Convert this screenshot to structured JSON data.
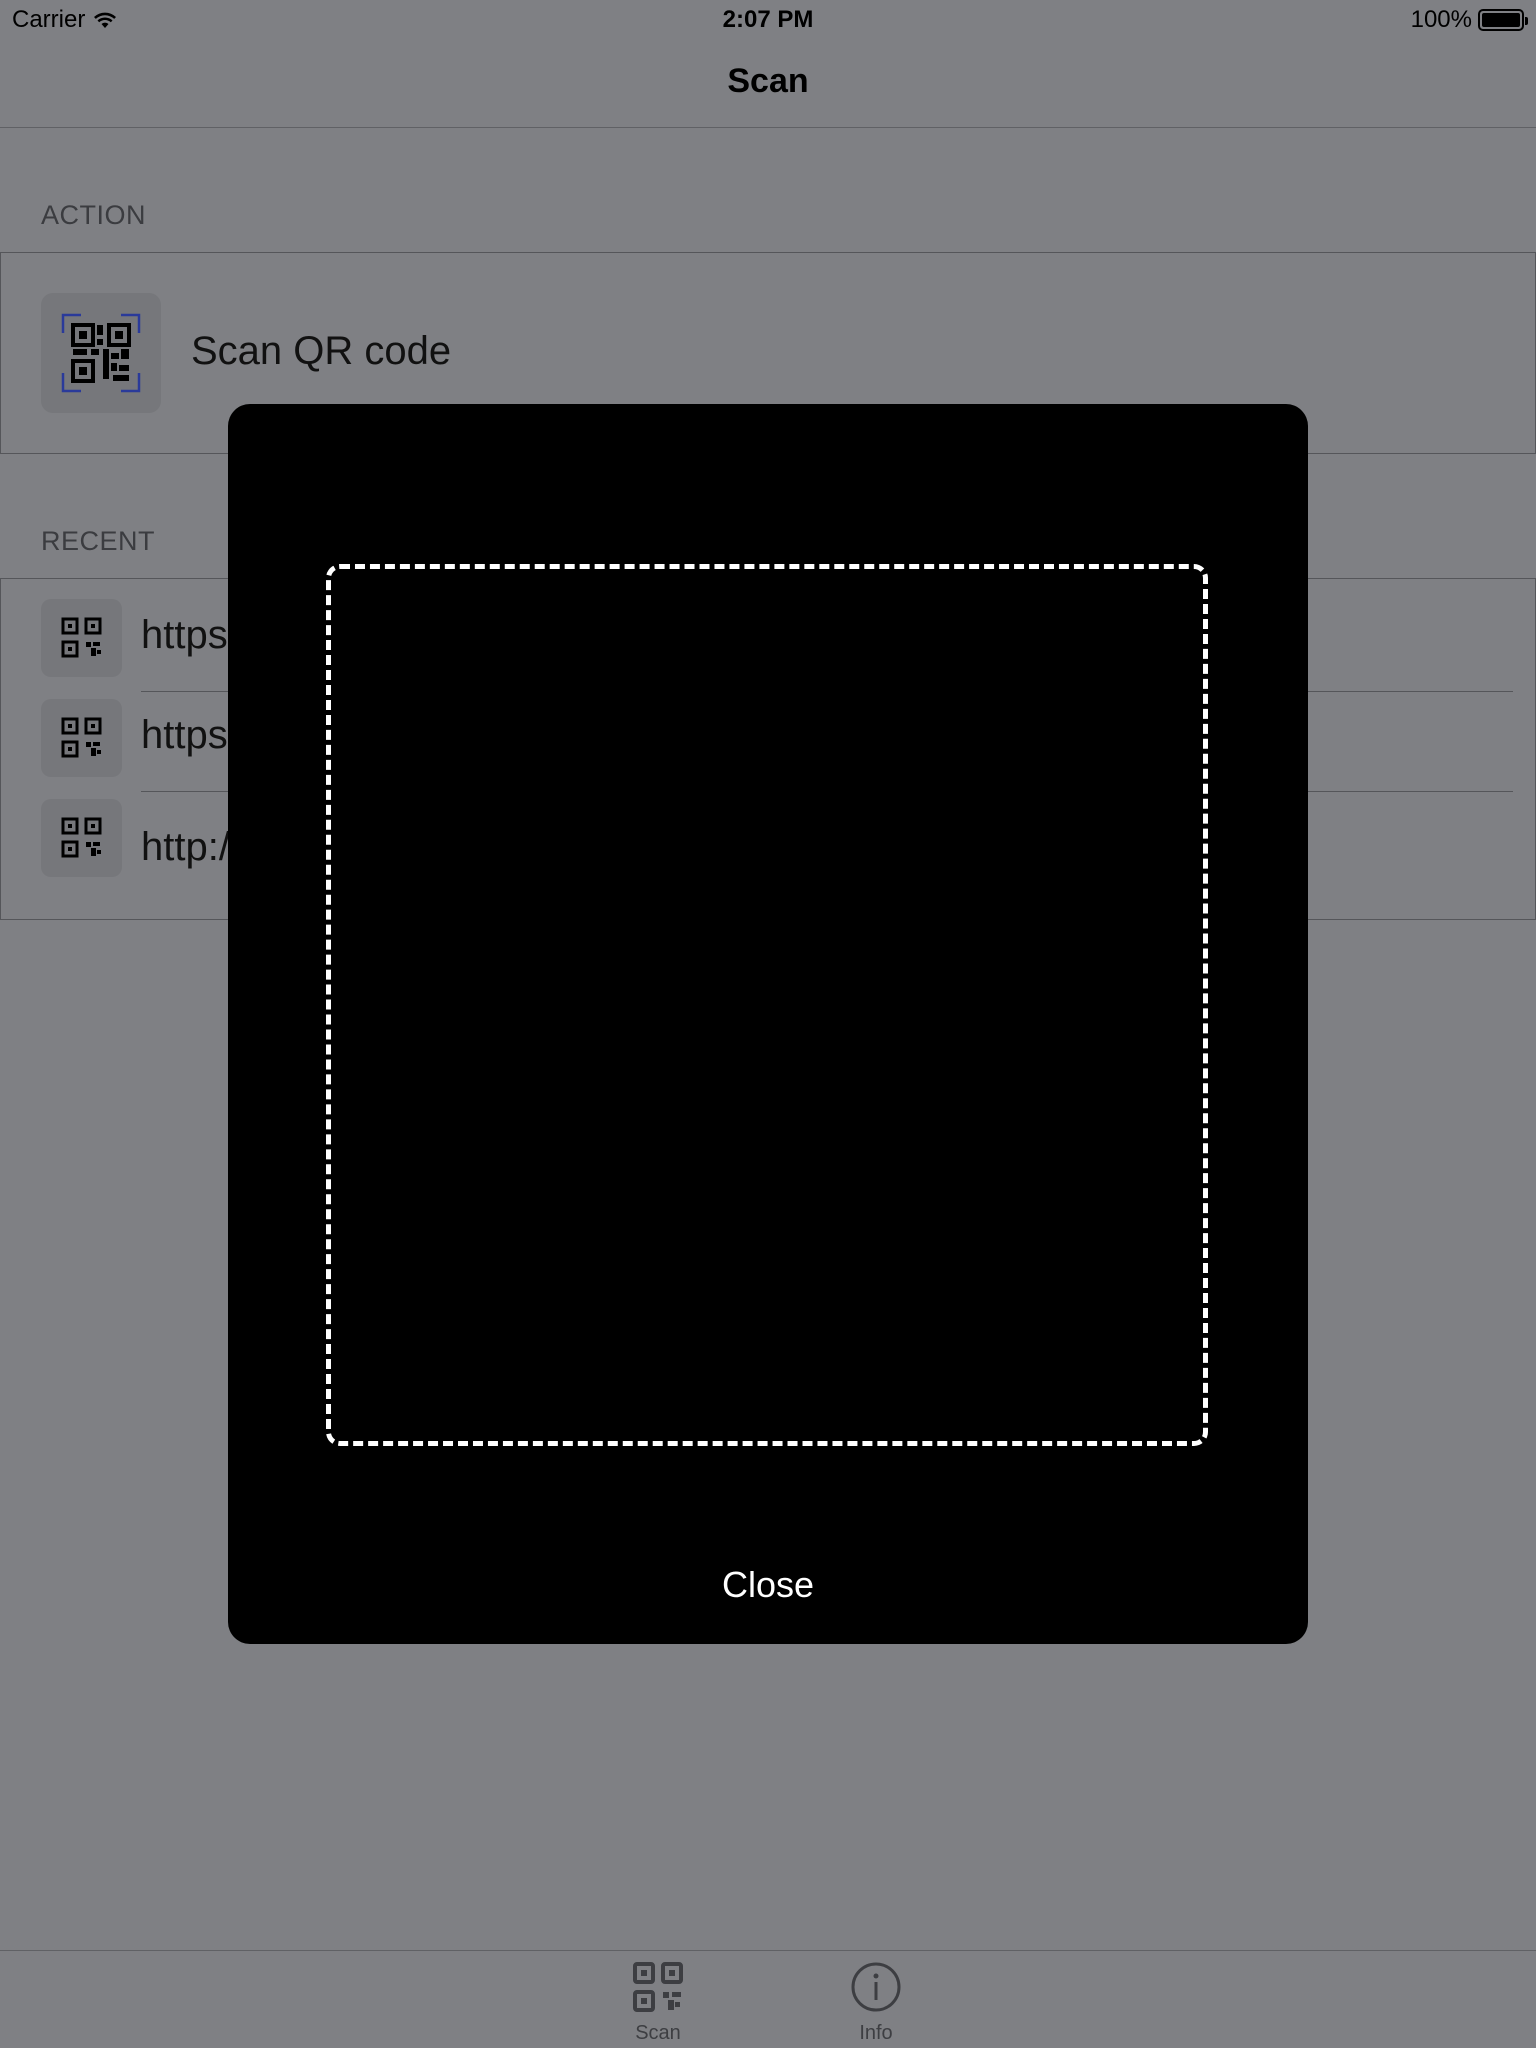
{
  "status_bar": {
    "carrier": "Carrier",
    "wifi_icon": "wifi-icon",
    "time": "2:07 PM",
    "battery": "100%",
    "battery_level": 1.0
  },
  "nav": {
    "title": "Scan"
  },
  "action_section": {
    "header": "ACTION",
    "item_label": "Scan QR code",
    "icon": "qr-scan-icon"
  },
  "recent_section": {
    "header": "RECENT",
    "items": [
      {
        "label": "https",
        "icon": "qr-code-icon"
      },
      {
        "label": "https",
        "icon": "qr-code-icon"
      },
      {
        "label": "http:/",
        "icon": "qr-code-icon"
      }
    ]
  },
  "modal": {
    "close_label": "Close"
  },
  "tabs": [
    {
      "label": "Scan",
      "icon": "qr-code-icon",
      "selected": true
    },
    {
      "label": "Info",
      "icon": "info-icon",
      "selected": false
    }
  ],
  "colors": {
    "background": "#7f8084",
    "modal": "#000000",
    "scan_frame": "#ffffff",
    "qr_bracket": "#2a3a9a"
  }
}
